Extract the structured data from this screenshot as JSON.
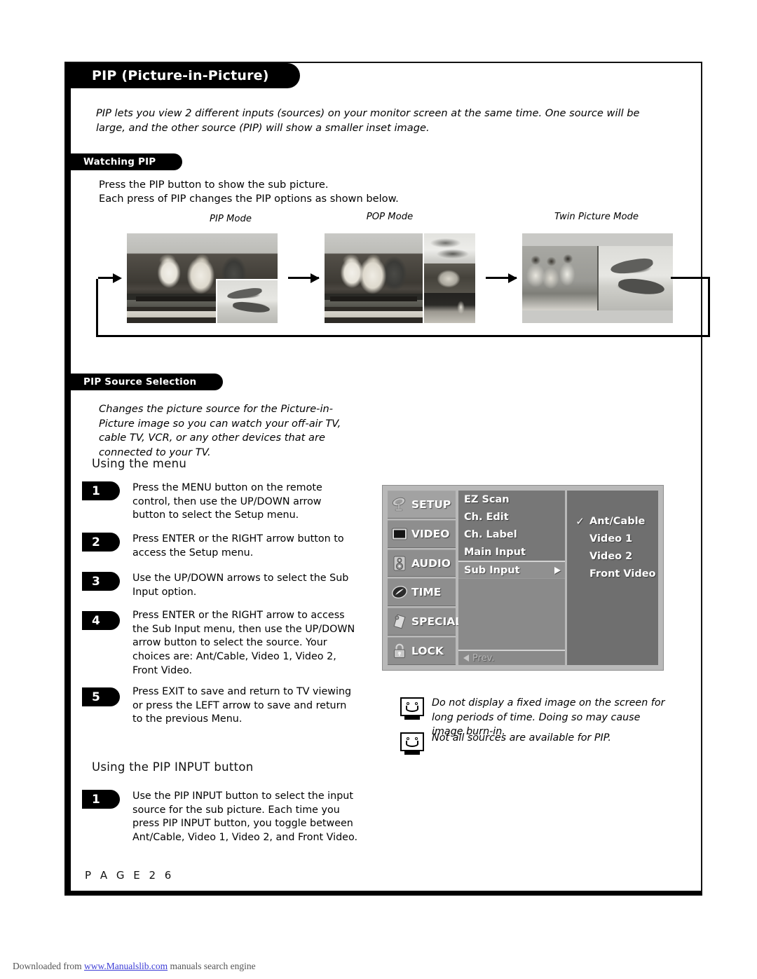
{
  "header": {
    "title": "PIP (Picture-in-Picture)"
  },
  "intro": "PIP lets you view 2 different inputs (sources) on your monitor screen at the same time. One source will be large, and the other source (PIP) will show a smaller inset image.",
  "watching": {
    "heading": "Watching PIP",
    "line1": "Press the PIP button to show the sub picture.",
    "line2": "Each press of PIP changes the PIP options as shown below.",
    "modes": [
      {
        "label": "PIP Mode"
      },
      {
        "label": "POP Mode"
      },
      {
        "label": "Twin Picture Mode"
      }
    ]
  },
  "source_selection": {
    "heading": "PIP Source Selection",
    "description": "Changes the picture source for the Picture-in-Picture image so you can watch your off-air TV, cable TV, VCR, or any other devices that are connected to your TV.",
    "menu_heading": "Using the menu",
    "steps": [
      {
        "num": "1",
        "text": "Press the MENU button on the remote control, then use the UP/DOWN arrow button to select the Setup menu."
      },
      {
        "num": "2",
        "text": "Press ENTER or the RIGHT arrow button to access the Setup menu."
      },
      {
        "num": "3",
        "text": "Use the UP/DOWN arrows to select the Sub Input option."
      },
      {
        "num": "4",
        "text": "Press ENTER or the RIGHT arrow to access the Sub Input menu, then use the UP/DOWN arrow button to select the source. Your choices are: Ant/Cable, Video 1, Video 2, Front Video."
      },
      {
        "num": "5",
        "text": "Press EXIT to save and return to TV viewing or press the LEFT arrow to save and return to the previous Menu."
      }
    ],
    "pip_input_heading": "Using the PIP INPUT button",
    "pip_input_steps": [
      {
        "num": "1",
        "text": "Use the PIP INPUT button to select the input source for the sub picture. Each time you press PIP INPUT button, you toggle between Ant/Cable, Video 1, Video 2, and Front Video."
      }
    ]
  },
  "osd": {
    "categories": [
      {
        "label": "SETUP",
        "icon": "satellite-dish-icon",
        "active": true
      },
      {
        "label": "VIDEO",
        "icon": "tv-screen-icon",
        "active": false
      },
      {
        "label": "AUDIO",
        "icon": "speaker-icon",
        "active": false
      },
      {
        "label": "TIME",
        "icon": "clock-icon",
        "active": false
      },
      {
        "label": "SPECIAL",
        "icon": "tag-icon",
        "active": false
      },
      {
        "label": "LOCK",
        "icon": "padlock-icon",
        "active": false
      }
    ],
    "items": [
      {
        "label": "EZ Scan",
        "selected": false,
        "arrow": false
      },
      {
        "label": "Ch. Edit",
        "selected": false,
        "arrow": false
      },
      {
        "label": "Ch. Label",
        "selected": false,
        "arrow": false
      },
      {
        "label": "Main Input",
        "selected": false,
        "arrow": false
      },
      {
        "label": "Sub Input",
        "selected": true,
        "arrow": true
      }
    ],
    "prev_label": "Prev.",
    "options": [
      {
        "label": "Ant/Cable",
        "checked": true
      },
      {
        "label": "Video 1",
        "checked": false
      },
      {
        "label": "Video 2",
        "checked": false
      },
      {
        "label": "Front Video",
        "checked": false
      }
    ],
    "colors": {
      "panel": "#b9b9b9",
      "side": "#8e8e8e",
      "side_active": "#a2a2a2",
      "mid": "#777777",
      "mid_sel": "#909090",
      "right": "#6f6f6f"
    }
  },
  "notes": [
    {
      "icon": "sad-tv-icon",
      "text": "Do not display a fixed image on the screen for long periods of  time. Doing so may cause image burn-in."
    },
    {
      "icon": "sad-tv-icon",
      "text": "Not all sources are available for PIP."
    }
  ],
  "page_number": "P A G E   2 6",
  "footer": {
    "prefix": "Downloaded from ",
    "link": "www.Manualslib.com",
    "suffix": " manuals search engine"
  }
}
